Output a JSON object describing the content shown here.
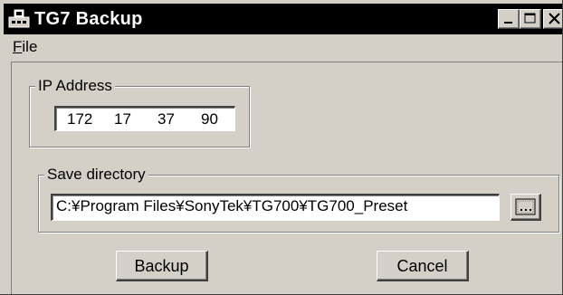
{
  "window": {
    "title": "TG7 Backup",
    "icon": "app-icon",
    "controls": [
      "minimize-icon",
      "maximize-icon",
      "close-icon"
    ]
  },
  "menu": {
    "file_mnemonic": "F",
    "file_rest": "ile"
  },
  "ip_address": {
    "label": "IP Address",
    "octets": [
      "172",
      "17",
      "37",
      "90"
    ]
  },
  "save_directory": {
    "label": "Save directory",
    "path": "C:¥Program Files¥SonyTek¥TG700¥TG700_Preset",
    "browse_icon": "browse-ellipsis-icon"
  },
  "buttons": {
    "backup": "Backup",
    "cancel": "Cancel"
  },
  "colors": {
    "face": "#d4d0c8",
    "titlebar": "#000000",
    "title_text": "#ffffff",
    "field": "#ffffff"
  }
}
